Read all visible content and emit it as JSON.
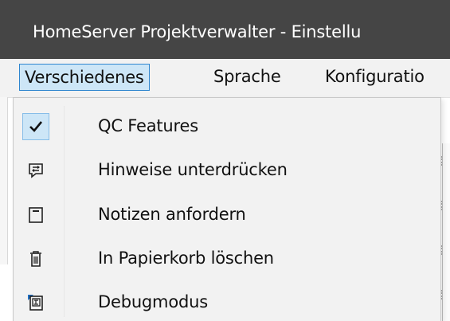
{
  "window": {
    "title": "HomeServer Projektverwalter - Einstellu"
  },
  "menubar": {
    "items": [
      {
        "label": "Verschiedenes",
        "active": true
      },
      {
        "label": "Sprache"
      },
      {
        "label": "Konfiguratio"
      }
    ]
  },
  "dropdown": {
    "items": [
      {
        "label": "QC Features",
        "icon": "check-icon",
        "checked": true
      },
      {
        "label": "Hinweise unterdrücken",
        "icon": "speech-bubble-icon"
      },
      {
        "label": "Notizen anfordern",
        "icon": "note-icon"
      },
      {
        "label": "In Papierkorb löschen",
        "icon": "trash-icon"
      },
      {
        "label": "Debugmodus",
        "icon": "debug-icon"
      }
    ]
  },
  "colors": {
    "titlebar": "#454545",
    "menubar": "#f2f2f2",
    "active_menu_bg": "#cde6f7",
    "active_menu_border": "#2e86cf",
    "dropdown_bg": "#f2f2f2"
  }
}
